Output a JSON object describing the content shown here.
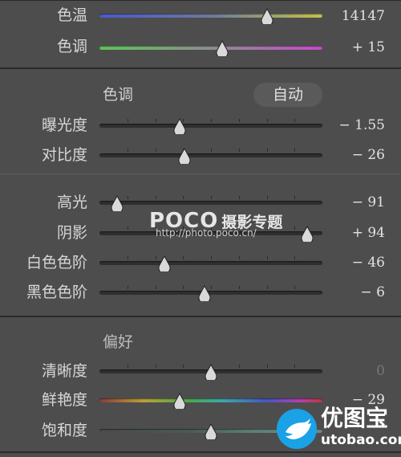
{
  "white_balance": {
    "temp": {
      "label": "色温",
      "value": "14147",
      "position": 0.75
    },
    "tint": {
      "label": "色调",
      "value": "+ 15",
      "position": 0.55
    }
  },
  "tone": {
    "title": "色调",
    "auto_label": "自动",
    "exposure": {
      "label": "曝光度",
      "value": "− 1.55",
      "position": 0.36
    },
    "contrast": {
      "label": "对比度",
      "value": "− 26",
      "position": 0.38
    }
  },
  "highlights_shadows": {
    "highlights": {
      "label": "高光",
      "value": "− 91",
      "position": 0.08
    },
    "shadows": {
      "label": "阴影",
      "value": "+ 94",
      "position": 0.93
    },
    "whites": {
      "label": "白色色阶",
      "value": "− 46",
      "position": 0.29
    },
    "blacks": {
      "label": "黑色色阶",
      "value": "− 6",
      "position": 0.47
    }
  },
  "presence": {
    "title": "偏好",
    "clarity": {
      "label": "清晰度",
      "value": "0",
      "position": 0.5
    },
    "vibrance": {
      "label": "鲜艳度",
      "value": "− 29",
      "position": 0.36
    },
    "saturation": {
      "label": "饱和度",
      "value": "",
      "position": 0.5
    }
  },
  "watermark": {
    "brand": "POCO",
    "brand_cn": "摄影专题",
    "url": "http://photo.poco.cn/"
  },
  "logo": {
    "name": "优图宝",
    "url": "utobao.com",
    "icon": "bird-logo-icon"
  },
  "colors": {
    "panel_bg": "#4d4d4d",
    "divider": "#2a2a2a",
    "label": "#d7d7d7",
    "value": "#e2e2e2",
    "logo_blue": "#1aa1e6"
  }
}
